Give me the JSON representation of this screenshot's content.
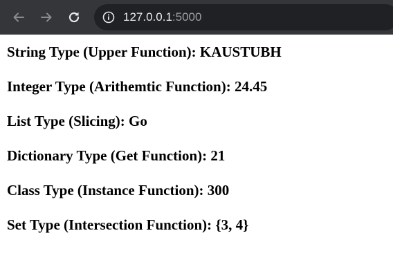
{
  "browser": {
    "url_host": "127.0.0.1",
    "url_port": ":5000",
    "icons": {
      "back": "back-arrow-icon",
      "forward": "forward-arrow-icon",
      "reload": "reload-icon",
      "info": "info-icon"
    },
    "colors": {
      "toolbar": "#35363a",
      "omnibox": "#202124",
      "icon_dim": "#8a8b8f",
      "icon_bright": "#e8eaed"
    }
  },
  "page": {
    "lines": [
      "String Type (Upper Function): KAUSTUBH",
      "Integer Type (Arithemtic Function): 24.45",
      "List Type (Slicing): Go",
      "Dictionary Type (Get Function): 21",
      "Class Type (Instance Function): 300",
      "Set Type (Intersection Function): {3, 4}"
    ]
  }
}
